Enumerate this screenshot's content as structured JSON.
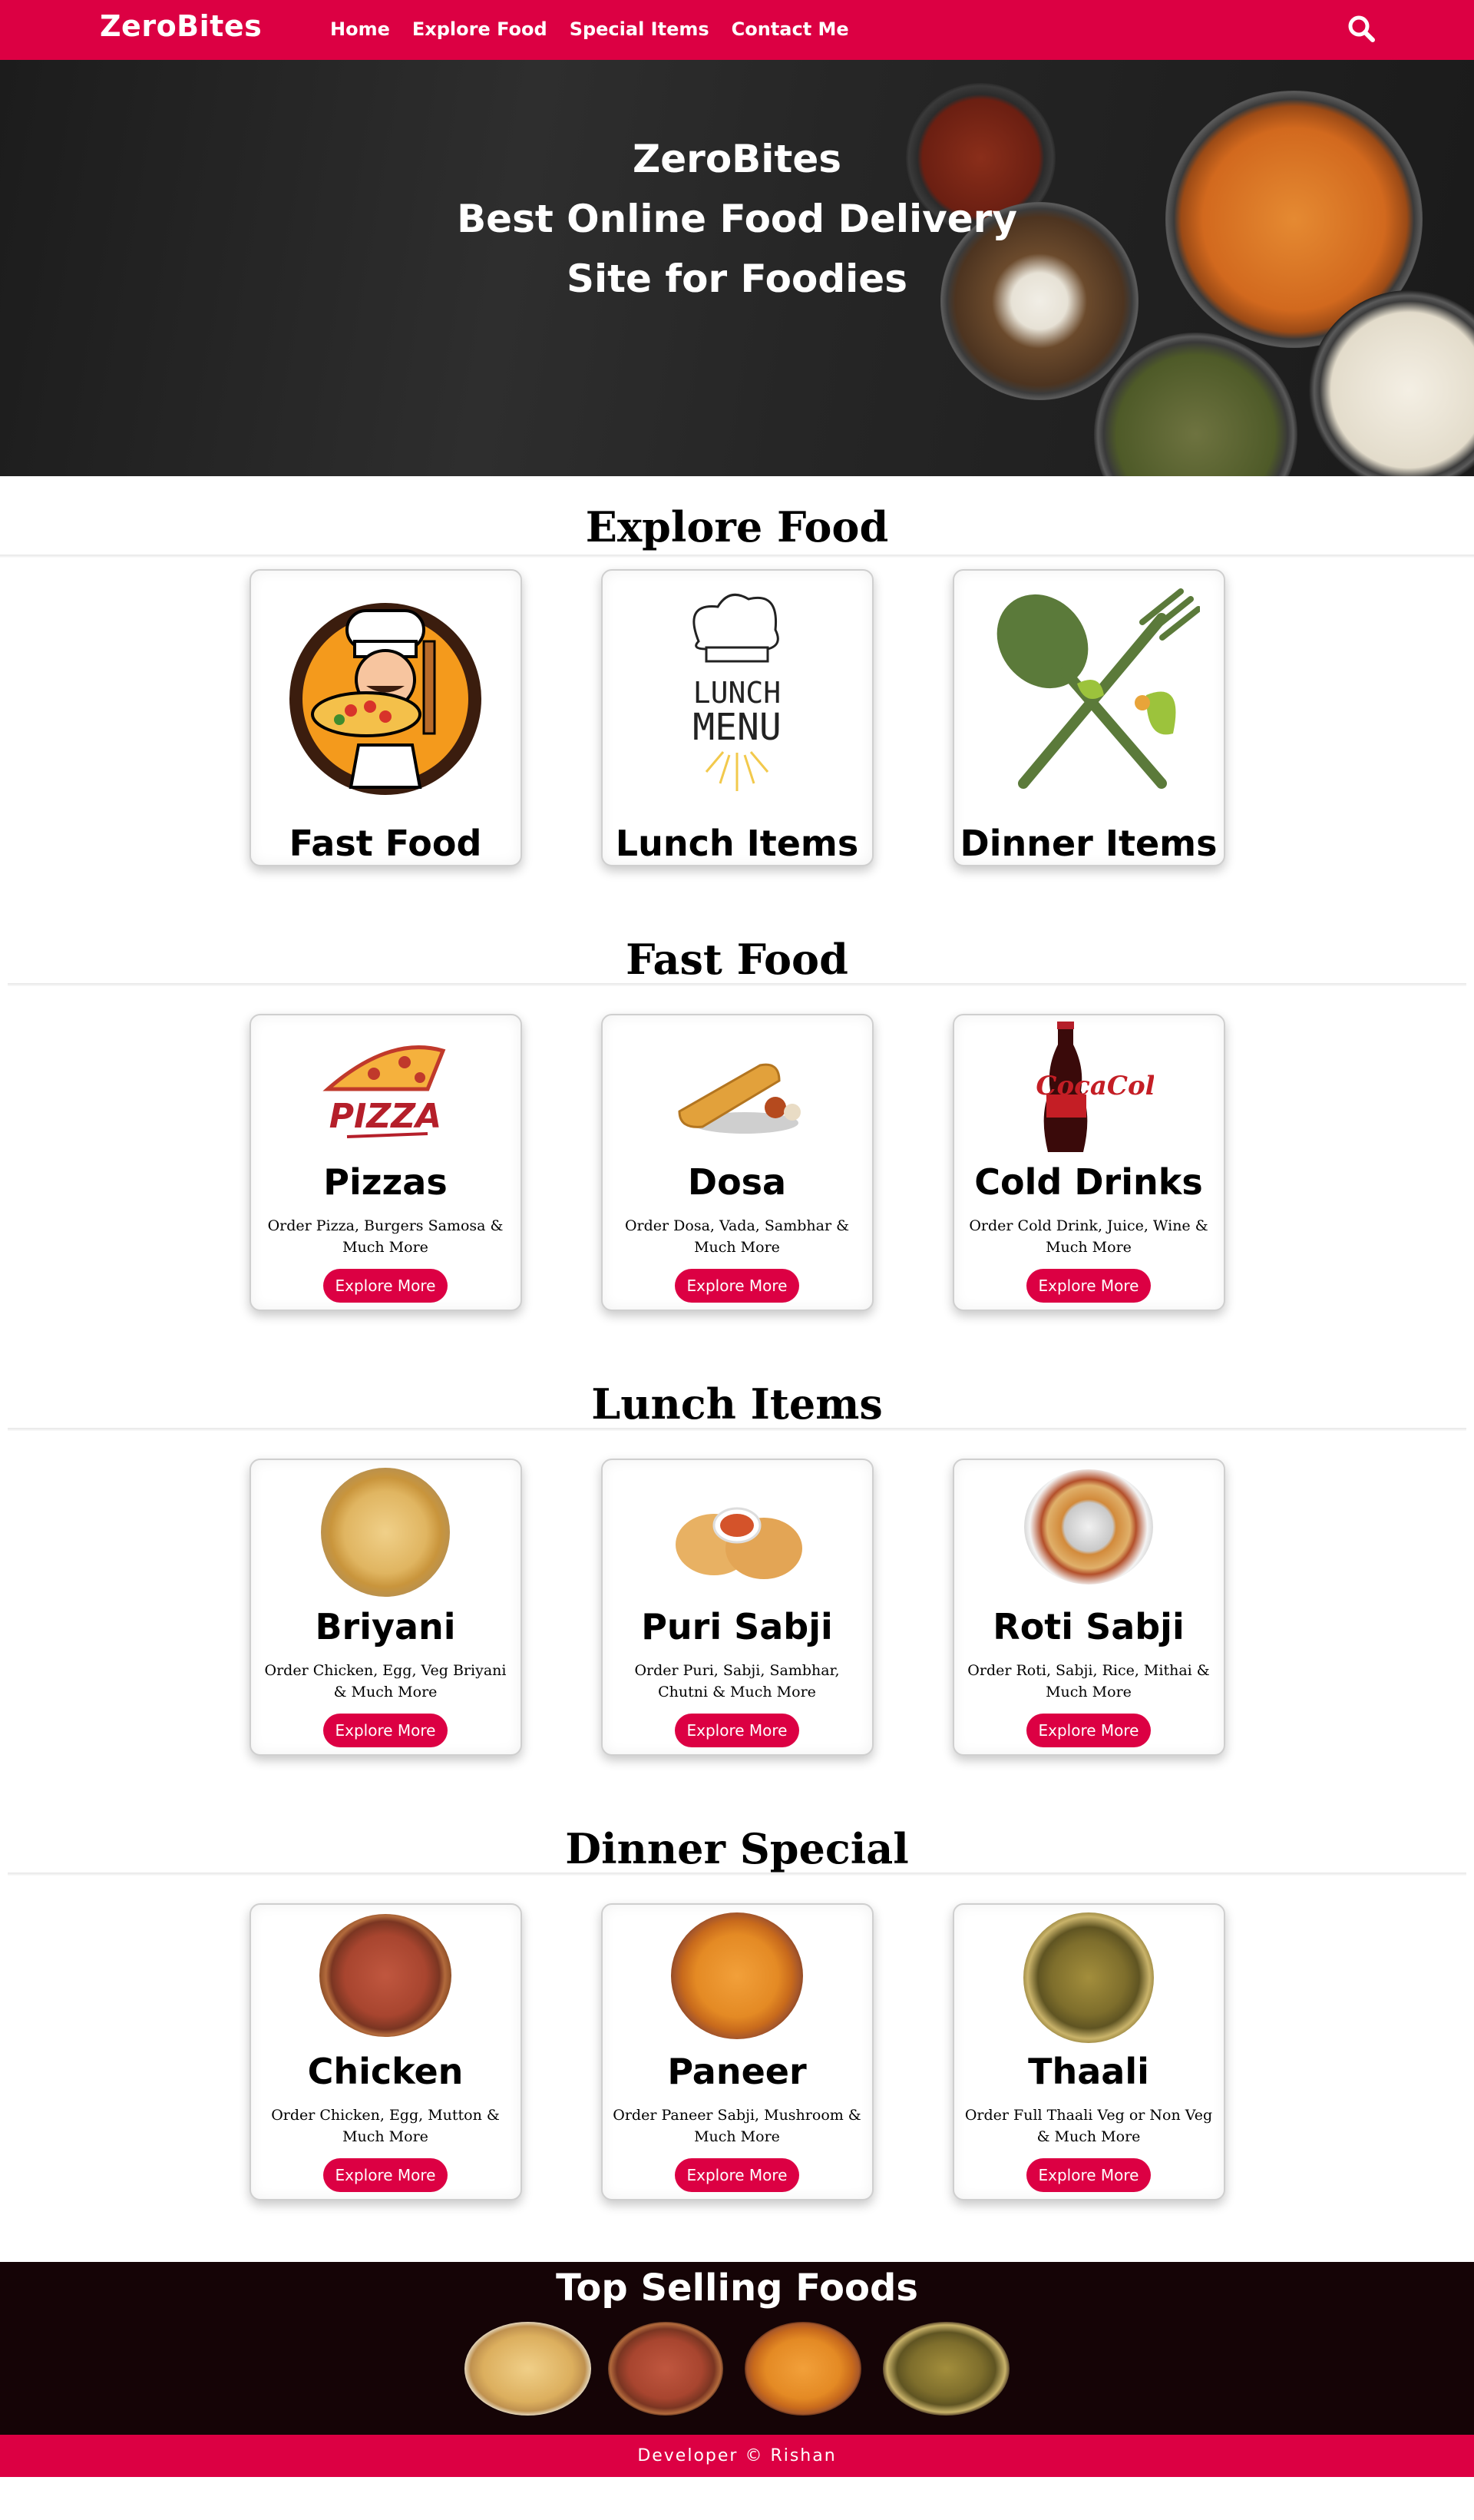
{
  "nav": {
    "brand": "ZeroBites",
    "links": [
      "Home",
      "Explore Food",
      "Special Items",
      "Contact Me"
    ],
    "search_icon": "search-icon"
  },
  "hero": {
    "line1": "ZeroBites",
    "line2": "Best Online Food Delivery",
    "line3": "Site for Foodies"
  },
  "explore": {
    "title": "Explore Food",
    "cards": [
      {
        "title": "Fast Food",
        "image": "chef-pizza-illustration"
      },
      {
        "title": "Lunch Items",
        "image": "lunch-menu-illustration"
      },
      {
        "title": "Dinner Items",
        "image": "spoon-fork-illustration"
      }
    ]
  },
  "fast_food": {
    "title": "Fast Food",
    "cards": [
      {
        "title": "Pizzas",
        "desc": "Order Pizza, Burgers Samosa & Much More",
        "button": "Explore More"
      },
      {
        "title": "Dosa",
        "desc": "Order Dosa, Vada, Sambhar & Much More",
        "button": "Explore More"
      },
      {
        "title": "Cold Drinks",
        "desc": "Order Cold Drink, Juice, Wine & Much More",
        "button": "Explore More"
      }
    ]
  },
  "lunch": {
    "title": "Lunch Items",
    "cards": [
      {
        "title": "Briyani",
        "desc": "Order Chicken, Egg, Veg Briyani & Much More",
        "button": "Explore More"
      },
      {
        "title": "Puri Sabji",
        "desc": "Order Puri, Sabji, Sambhar, Chutni & Much More",
        "button": "Explore More"
      },
      {
        "title": "Roti Sabji",
        "desc": "Order Roti, Sabji, Rice, Mithai & Much More",
        "button": "Explore More"
      }
    ]
  },
  "dinner": {
    "title": "Dinner Special",
    "cards": [
      {
        "title": "Chicken",
        "desc": "Order Chicken, Egg, Mutton & Much More",
        "button": "Explore More"
      },
      {
        "title": "Paneer",
        "desc": "Order Paneer Sabji, Mushroom & Much More",
        "button": "Explore More"
      },
      {
        "title": "Thaali",
        "desc": "Order Full Thaali Veg or Non Veg & Much More",
        "button": "Explore More"
      }
    ]
  },
  "top_selling": {
    "title": "Top Selling Foods"
  },
  "footer": {
    "text": "Developer © Rishan"
  },
  "colors": {
    "accent": "#dc0043",
    "dark_band": "#150406"
  }
}
